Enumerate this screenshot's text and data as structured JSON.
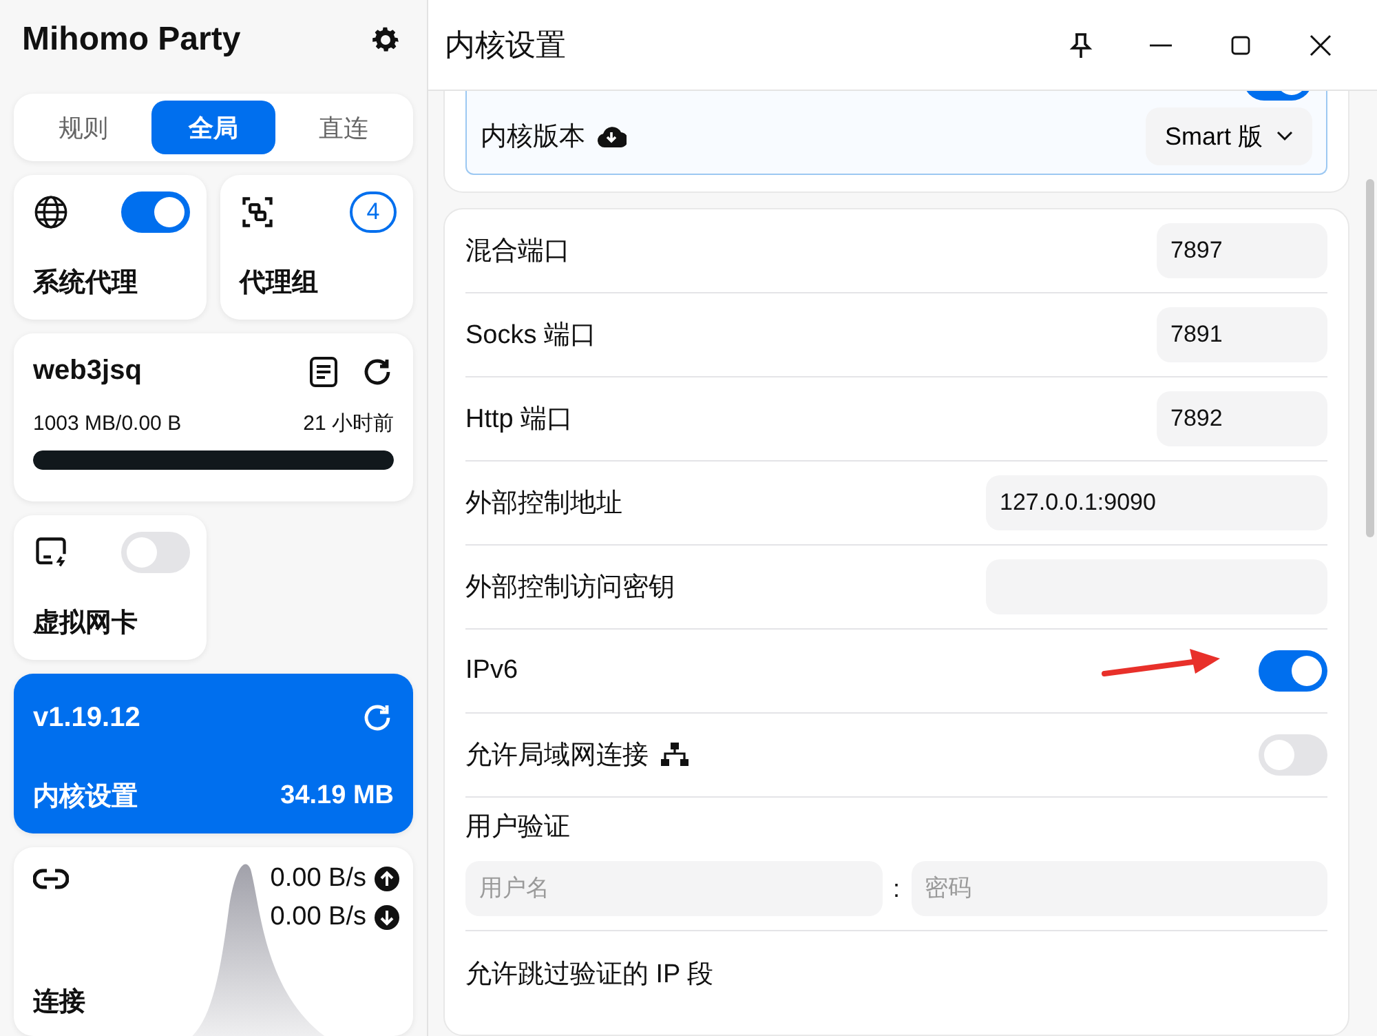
{
  "app": {
    "title": "Mihomo Party"
  },
  "modes": [
    {
      "label": "规则",
      "selected": false
    },
    {
      "label": "全局",
      "selected": true
    },
    {
      "label": "直连",
      "selected": false
    }
  ],
  "tiles": [
    {
      "kind": "toggle",
      "label": "系统代理",
      "on": true
    },
    {
      "kind": "count",
      "label": "代理组",
      "count": "4"
    }
  ],
  "profile": {
    "name": "web3jsq",
    "usage": "1003 MB/0.00 B",
    "updated": "21 小时前",
    "level": 1
  },
  "tun": {
    "label": "虚拟网卡",
    "on": false
  },
  "core": {
    "version": "v1.19.12",
    "label": "内核设置",
    "memory": "34.19 MB",
    "selected": true
  },
  "connections": {
    "label": "连接",
    "upload": "0.00 B/s",
    "download": "0.00 B/s"
  },
  "page": {
    "title": "内核设置"
  },
  "core_card": {
    "partial_toggle_on": true,
    "version_label": "内核版本",
    "version_value": "Smart 版"
  },
  "settings": [
    {
      "kind": "port",
      "label": "混合端口",
      "value": "7897"
    },
    {
      "kind": "port",
      "label": "Socks 端口",
      "value": "7891"
    },
    {
      "kind": "port",
      "label": "Http 端口",
      "value": "7892"
    },
    {
      "kind": "text",
      "label": "外部控制地址",
      "value": "127.0.0.1:9090"
    },
    {
      "kind": "text",
      "label": "外部控制访问密钥"
    },
    {
      "kind": "toggle",
      "label": "IPv6",
      "on": true,
      "pointer": true
    },
    {
      "kind": "toggle",
      "label": "允许局域网连接",
      "on": false,
      "network_icon": true
    },
    {
      "kind": "auth",
      "label": "用户验证",
      "username_placeholder": "用户名",
      "password_placeholder": "密码",
      "separator": ":"
    },
    {
      "kind": "heading",
      "label": "允许跳过验证的 IP 段"
    }
  ]
}
